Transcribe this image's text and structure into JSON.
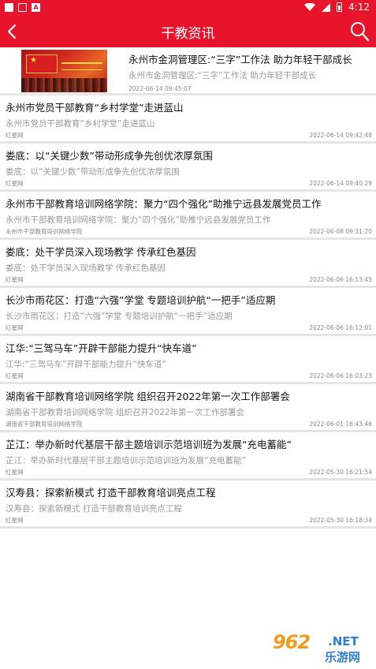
{
  "status_bar": {
    "time": "4:12"
  },
  "app_bar": {
    "title": "干教资讯"
  },
  "featured": {
    "title": "永州市金洞管理区:“三字”工作法 助力年轻干部成长",
    "summary": "永州市金洞管理区:“三字”工作法 助力年轻干部成长",
    "time": "2022-06-14 09:45:07",
    "image_icon": "news-photo"
  },
  "items": [
    {
      "title": "永州市党员干部教育“乡村学堂”走进蓝山",
      "summary": "永州市党员干部教育“乡村学堂”走进蓝山",
      "source": "红星网",
      "time": "2022-06-14 09:42:48"
    },
    {
      "title": "娄底：以“关键少数”带动形成争先创优浓厚氛围",
      "summary": "娄底：以“关键少数”带动形成争先创优浓厚氛围",
      "source": "红星网",
      "time": "2022-06-14 09:40:29"
    },
    {
      "title": "永州市干部教育培训网络学院：聚力“四个强化”助推宁远县发展党员工作",
      "summary": "永州市干部教育培训网络学院：聚力“四个强化”助推宁远县发展党员工作",
      "source": "永州市干部教育培训网络学院",
      "time": "2022-06-08 09:31:20"
    },
    {
      "title": "娄底：处干学员深入现场教学 传承红色基因",
      "summary": "娄底：处干学员深入现场教学 传承红色基因",
      "source": "红星网",
      "time": "2022-06-06 16:13:45"
    },
    {
      "title": "长沙市雨花区：打造“六强”学堂 专题培训护航“一把手”适应期",
      "summary": "长沙市雨花区：打造“六强”学堂 专题培训护航“一把手”适应期",
      "source": "红星网",
      "time": "2022-06-06 16:12:01"
    },
    {
      "title": "江华:“三驾马车”开辟干部能力提升“快车道”",
      "summary": "江华:“三驾马车”开辟干部能力提升“快车道”",
      "source": "红星网",
      "time": "2022-06-06 16:03:23"
    },
    {
      "title": "湖南省干部教育培训网络学院 组织召开2022年第一次工作部署会",
      "summary": "湖南省干部教育培训网络学院 组织召开2022年第一次工作部署会",
      "source": "湖南省干部教育培训网络学院",
      "time": "2022-06-01 16:43:46"
    },
    {
      "title": "芷江：举办新时代基层干部主题培训示范培训班为发展“充电蓄能”",
      "summary": "芷江：举办新时代基层干部主题培训示范培训班为发展“充电蓄能”",
      "source": "红星网",
      "time": "2022-05-30 16:21:54"
    },
    {
      "title": "汉寿县：探索新模式 打造干部教育培训亮点工程",
      "summary": "汉寿县：探索新模式 打造干部教育培训亮点工程",
      "source": "红星网",
      "time": "2022-05-30 16:18:34"
    }
  ],
  "watermark": {
    "number": "962",
    "domain": ".NET",
    "cn": "乐游网"
  },
  "colors": {
    "accent": "#e8142c",
    "divider": "#e5e5e5",
    "muted": "#999999"
  }
}
